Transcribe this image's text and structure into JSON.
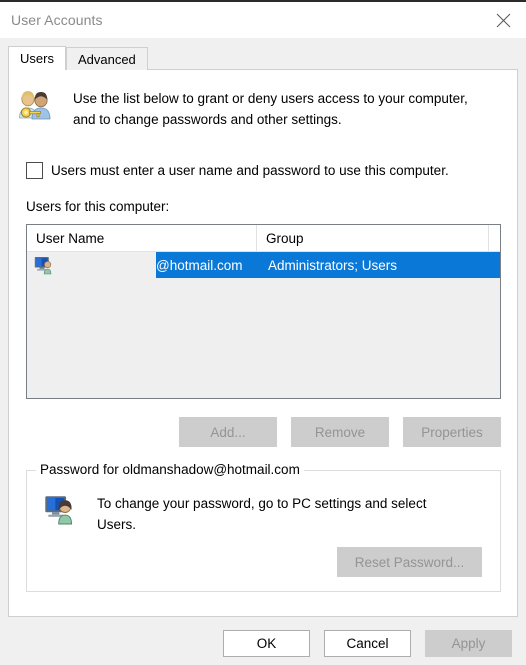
{
  "window": {
    "title": "User Accounts",
    "close_icon": "close-icon"
  },
  "tabs": [
    {
      "label": "Users",
      "active": true
    },
    {
      "label": "Advanced",
      "active": false
    }
  ],
  "intro": {
    "icon": "users-key-icon",
    "text": "Use the list below to grant or deny users access to your computer, and to change passwords and other settings."
  },
  "require_password_checkbox": {
    "label": "Users must enter a user name and password to use this computer.",
    "checked": false
  },
  "users_list": {
    "label": "Users for this computer:",
    "columns": [
      "User Name",
      "Group",
      ""
    ],
    "rows": [
      {
        "icon": "user-computer-icon",
        "user_name": "@hotmail.com",
        "group": "Administrators; Users",
        "selected": true
      }
    ]
  },
  "list_buttons": [
    {
      "label": "Add...",
      "enabled": false
    },
    {
      "label": "Remove",
      "enabled": false
    },
    {
      "label": "Properties",
      "enabled": false
    }
  ],
  "password_group": {
    "legend": "Password for oldmanshadow@hotmail.com",
    "icon": "user-computer-icon",
    "text": "To change your password, go to PC settings and select Users.",
    "button": {
      "label": "Reset Password...",
      "enabled": false
    }
  },
  "footer_buttons": [
    {
      "label": "OK",
      "enabled": true
    },
    {
      "label": "Cancel",
      "enabled": true
    },
    {
      "label": "Apply",
      "enabled": false
    }
  ],
  "colors": {
    "selection": "#0a78d7",
    "dialog_bg": "#f0f0f0",
    "panel_bg": "#ffffff",
    "disabled_text": "#949494"
  }
}
